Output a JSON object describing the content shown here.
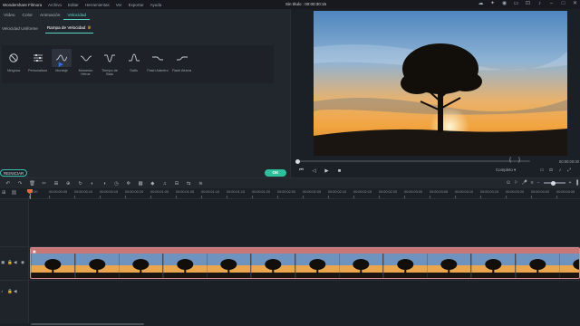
{
  "titlebar": {
    "app_title": "Wondershare Filmora",
    "menu": [
      "Archivo",
      "Editar",
      "Herramientas",
      "Ver",
      "Exportar",
      "Ayuda"
    ],
    "doc_title": "Sin título : 00:00:30:15"
  },
  "left_panel": {
    "tabs": [
      "Vídeo",
      "Color",
      "Animación",
      "Velocidad"
    ],
    "active_tab": "Velocidad",
    "subtabs": [
      "Velocidad Uniforme",
      "Rampa de Velocidad"
    ],
    "active_subtab": "Rampa de Velocidad",
    "presets": [
      {
        "label": "Ninguna",
        "icon": "none-icon"
      },
      {
        "label": "Personalizar",
        "icon": "sliders-icon"
      },
      {
        "label": "Montaje",
        "icon": "montage-curve-icon"
      },
      {
        "label": "Momento Héroe",
        "icon": "hero-curve-icon"
      },
      {
        "label": "Tiempo de Bala",
        "icon": "bullet-time-curve-icon"
      },
      {
        "label": "Salto",
        "icon": "jumper-curve-icon"
      },
      {
        "label": "Flash Adentro",
        "icon": "flash-in-curve-icon"
      },
      {
        "label": "Flash Afuera",
        "icon": "flash-out-curve-icon"
      }
    ],
    "reset_label": "REINICIAR",
    "ok_label": "OK"
  },
  "preview": {
    "timecode": "00:00:00:00",
    "quality": "Completo",
    "progress": 0
  },
  "ruler": {
    "labels": [
      "00:00",
      "00:00:00:05",
      "00:00:00:10",
      "00:00:00:15",
      "00:00:00:20",
      "00:00:01:00",
      "00:00:01:05",
      "00:00:01:10",
      "00:00:01:15",
      "00:00:01:20",
      "00:00:02:00",
      "00:00:02:05",
      "00:00:02:10",
      "00:00:02:15",
      "00:00:02:20",
      "00:00:03:00",
      "00:00:03:05",
      "00:00:03:10",
      "00:00:03:15",
      "00:00:03:20",
      "00:00:04:00",
      "00:00:04:05",
      "00:00:04:10",
      "00:00:04:15",
      "00:00:04:20"
    ]
  },
  "colors": {
    "accent": "#58d7c6",
    "ok_button": "#2ec09c",
    "playhead": "#e86a3a",
    "clip_border": "#d98a8a"
  }
}
